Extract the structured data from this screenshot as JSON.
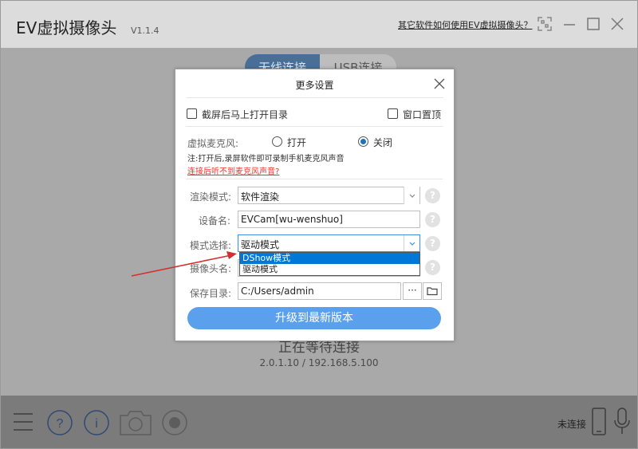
{
  "app": {
    "title": "EV虚拟摄像头",
    "version": "V1.1.4",
    "help_link": "其它软件如何使用EV虚拟摄像头？"
  },
  "tabs": [
    {
      "label": "无线连接",
      "active": true
    },
    {
      "label": "USB连接",
      "active": false
    }
  ],
  "status": {
    "title": "正在等待连接",
    "sub": "2.0.1.10 / 192.168.5.100"
  },
  "bottom": {
    "connection_status": "未连接"
  },
  "dialog": {
    "title": "更多设置",
    "open_dir_after_screenshot": {
      "label": "截屏后马上打开目录",
      "checked": false
    },
    "window_on_top": {
      "label": "窗口置顶",
      "checked": false
    },
    "mic": {
      "label": "虚拟麦克风:",
      "opt_on": "打开",
      "opt_off": "关闭",
      "selected": "关闭",
      "note": "注:打开后,录屏软件即可录制手机麦克风声音",
      "help_link": "连接后听不到麦克风声音?"
    },
    "render_mode": {
      "label": "渲染模式:",
      "value": "软件渲染"
    },
    "device_name": {
      "label": "设备名:",
      "value": "EVCam[wu-wenshuo]"
    },
    "mode_select": {
      "label": "模式选择:",
      "value": "驱动模式",
      "options": [
        "DShow模式",
        "驱动模式"
      ],
      "highlighted": "DShow模式"
    },
    "camera_name": {
      "label": "摄像头名:"
    },
    "save_dir": {
      "label": "保存目录:",
      "value": "C:/Users/admin",
      "more": "···"
    },
    "upgrade_button": "升级到最新版本",
    "help_mark": "?"
  },
  "colors": {
    "accent": "#5aa0ec",
    "selection": "#0078d7",
    "link_red": "#e53935",
    "arrow_red": "#d32f2f"
  }
}
